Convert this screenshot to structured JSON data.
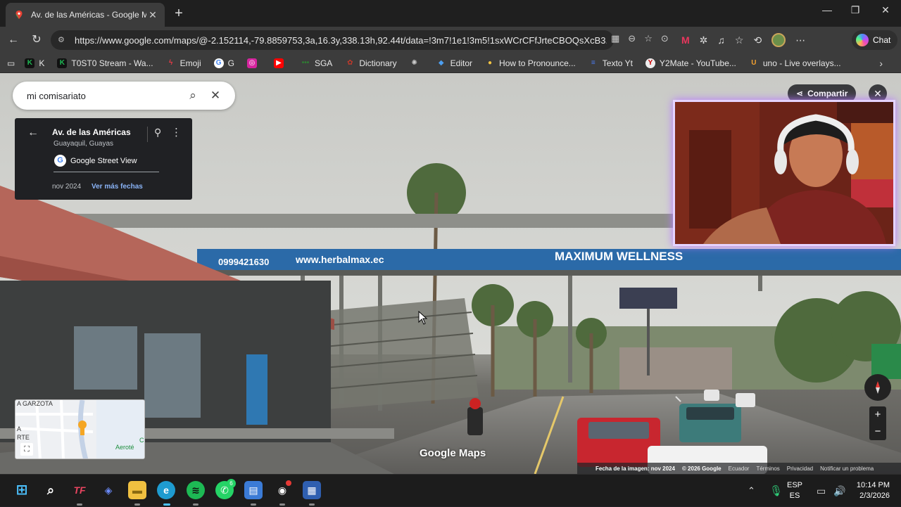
{
  "browser": {
    "tab_title": "Av. de las Américas - Google Maps",
    "url": "https://www.google.com/maps/@-2.152114,-79.8859753,3a,16.3y,338.13h,92.44t/data=!3m7!1e1!3m5!1sxWCrCFfJrteCBOQsXcB3...",
    "chat_label": "Chat",
    "bookmarks": [
      {
        "label": "K",
        "icon": "k-icon",
        "color": "#1db954"
      },
      {
        "label": "T0ST0 Stream - Wa...",
        "icon": "k-icon",
        "color": "#1db954"
      },
      {
        "label": "Emoji",
        "icon": "bolt-icon",
        "color": "#e63946"
      },
      {
        "label": "G",
        "icon": "google-icon",
        "color": "#ffffff"
      },
      {
        "label": "",
        "icon": "instagram-icon",
        "color": "#d6249f"
      },
      {
        "label": "",
        "icon": "youtube-icon",
        "color": "#ff0000"
      },
      {
        "label": "SGA",
        "icon": "dots-icon",
        "color": "#2e7d32"
      },
      {
        "label": "Dictionary",
        "icon": "dictionary-icon",
        "color": "#c0392b"
      },
      {
        "label": "",
        "icon": "openai-icon",
        "color": "#cccccc"
      },
      {
        "label": "Editor",
        "icon": "editor-icon",
        "color": "#4d9ff0"
      },
      {
        "label": "How to Pronounce...",
        "icon": "speak-icon",
        "color": "#f4c542"
      },
      {
        "label": "Texto Yt",
        "icon": "doc-icon",
        "color": "#4d7cf0"
      },
      {
        "label": "Y2Mate - YouTube...",
        "icon": "y2mate-icon",
        "color": "#e0e0e0"
      },
      {
        "label": "uno - Live overlays...",
        "icon": "u-icon",
        "color": "#f0a030"
      }
    ]
  },
  "maps": {
    "search_query": "mi comisariato",
    "street_name": "Av. de las Américas",
    "city": "Guayaquil, Guayas",
    "provider": "Google Street View",
    "date": "nov 2024",
    "more_dates": "Ver más fechas",
    "share_label": "Compartir",
    "minimap_labels": {
      "top": "A GARZOTA",
      "left1": "A",
      "left2": "RTE",
      "right": "Aeroté",
      "rightc": "C"
    },
    "logo": "Google Maps",
    "attribution": {
      "image_date": "Fecha de la imagen: nov 2024",
      "copyright": "© 2026 Google",
      "country": "Ecuador",
      "terms": "Términos",
      "privacy": "Privacidad",
      "report": "Notificar un problema"
    },
    "scene_text": {
      "phone": "0999421630",
      "website": "www.herbalmax.ec",
      "slogan": "MAXIMUM WELLNESS"
    }
  },
  "taskbar": {
    "lang_top": "ESP",
    "lang_bottom": "ES",
    "time": "10:14 PM",
    "date": "2/3/2026",
    "whatsapp_badge": "6"
  }
}
